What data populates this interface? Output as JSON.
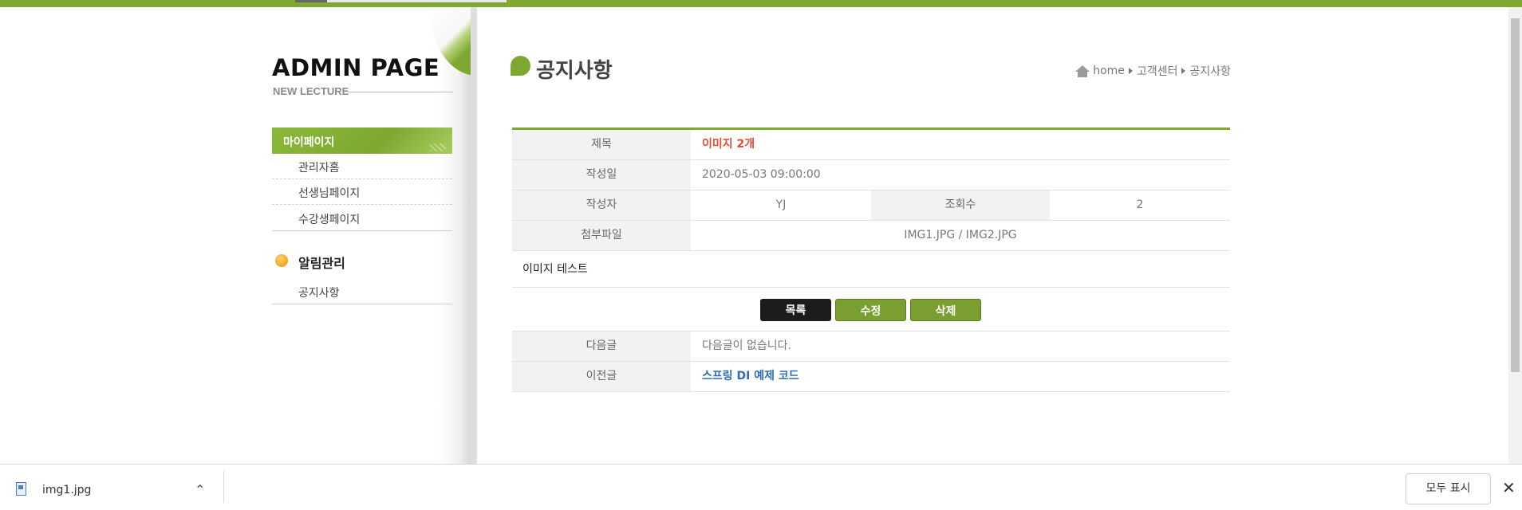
{
  "sidebar": {
    "logo_title": "ADMIN PAGE",
    "logo_subtitle": "NEW LECTURE",
    "section1_title": "마이페이지",
    "section1_items": [
      "관리자홈",
      "선생님페이지",
      "수강생페이지"
    ],
    "section2_title": "알림관리",
    "section2_items": [
      "공지사항"
    ]
  },
  "header": {
    "title": "공지사항",
    "breadcrumb": [
      "home",
      "고객센터",
      "공지사항"
    ]
  },
  "post": {
    "labels": {
      "title": "제목",
      "date": "작성일",
      "author": "작성자",
      "views": "조회수",
      "attachment": "첨부파일"
    },
    "title": "이미지 2개",
    "date": "2020-05-03 09:00:00",
    "author": "YJ",
    "views": "2",
    "attachment": "IMG1.JPG / IMG2.JPG",
    "body": "이미지 테스트"
  },
  "buttons": {
    "list": "목록",
    "edit": "수정",
    "delete": "삭제"
  },
  "nav": {
    "next_label": "다음글",
    "next_value": "다음글이 없습니다.",
    "prev_label": "이전글",
    "prev_value": "스프링 DI 예제 코드"
  },
  "download_bar": {
    "file_name": "img1.jpg",
    "show_all": "모두 표시"
  },
  "colors": {
    "accent": "#7ea830",
    "title_red": "#e7492b",
    "link_blue": "#2e6db3"
  }
}
